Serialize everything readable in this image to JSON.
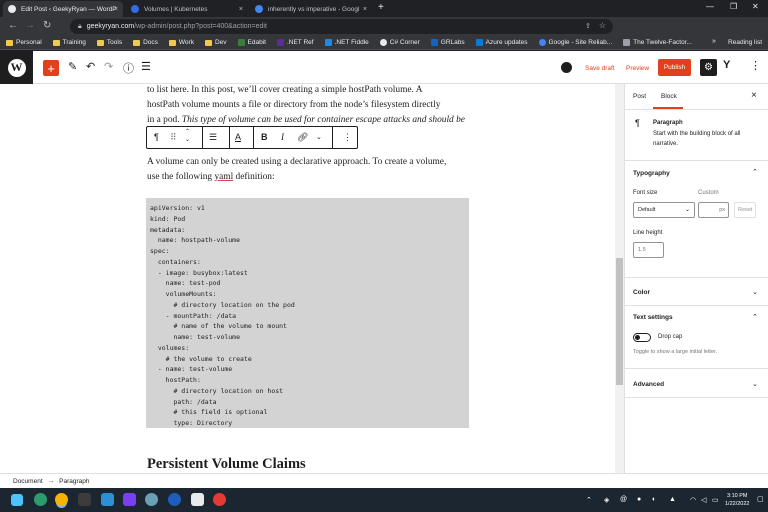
{
  "browser": {
    "tabs": [
      {
        "title": "Edit Post ‹ GeekyRyan — WordP",
        "close": "×"
      },
      {
        "title": "Volumes | Kubernetes",
        "close": "×"
      },
      {
        "title": "inherently vs imperative - Googl",
        "close": "×"
      }
    ],
    "new_tab": "+",
    "address": {
      "host": "geekyryan.com",
      "path": "/wp-admin/post.php?post=400&action=edit"
    },
    "bookmarks": [
      {
        "label": "Personal",
        "kind": "folder"
      },
      {
        "label": "Training",
        "kind": "folder"
      },
      {
        "label": "Tools",
        "kind": "folder"
      },
      {
        "label": "Docs",
        "kind": "folder"
      },
      {
        "label": "Work",
        "kind": "folder"
      },
      {
        "label": "Dev",
        "kind": "folder"
      },
      {
        "label": "Edabit",
        "kind": "site",
        "color": "#3b7d3b"
      },
      {
        "label": ".NET Ref",
        "kind": "site",
        "color": "#5c2d91"
      },
      {
        "label": ".NET Fiddle",
        "kind": "site",
        "color": "#1e88e5"
      },
      {
        "label": "C# Corner",
        "kind": "site",
        "color": "#e8eaed"
      },
      {
        "label": "GRLabs",
        "kind": "site",
        "color": "#1565c0"
      },
      {
        "label": "Azure updates",
        "kind": "site",
        "color": "#0a7bd4"
      },
      {
        "label": "Google - Site Reliab...",
        "kind": "site",
        "color": "#4285f4"
      },
      {
        "label": "The Twelve-Factor...",
        "kind": "site",
        "color": "#9aa0a6"
      }
    ],
    "reading_list": "Reading list"
  },
  "wp_header": {
    "save_draft": "Save draft",
    "preview": "Preview",
    "publish": "Publish"
  },
  "editor": {
    "para1": [
      "to list here. In this post, we’ll cover creating a simple hostPath volume. A",
      "hostPath volume mounts a file or directory from the node’s filesystem directly",
      "in a pod. "
    ],
    "para1_italic": "This type of volume can be used for container escape attacks and should be",
    "para2_line1": "A volume can only be created using a declarative approach. To create a volume,",
    "para2_line2_a": "use the following ",
    "para2_line2_link": "yaml",
    "para2_line2_b": " definition:",
    "code": "apiVersion: v1\nkind: Pod\nmetadata:\n  name: hostpath-volume\nspec:\n  containers:\n  - image: busybox:latest\n    name: test-pod\n    volumeMounts:\n      # directory location on the pod\n    - mountPath: /data\n      # name of the volume to mount\n      name: test-volume\n  volumes:\n    # the volume to create\n  - name: test-volume\n    hostPath:\n      # directory location on host\n      path: /data\n      # this field is optional\n      type: Directory",
    "heading": "Persistent Volume Claims"
  },
  "sidebar": {
    "tab_post": "Post",
    "tab_block": "Block",
    "close": "×",
    "block_name": "Paragraph",
    "block_desc1": "Start with the building block of all",
    "block_desc2": "narrative.",
    "typography": "Typography",
    "font_size_label": "Font size",
    "custom_label": "Custom",
    "font_size_value": "Default",
    "custom_unit": "px",
    "reset": "Reset",
    "line_height_label": "Line height",
    "line_height_placeholder": "1.5",
    "color": "Color",
    "text_settings": "Text settings",
    "drop_cap": "Drop cap",
    "drop_cap_help": "Toggle to show a large initial letter.",
    "advanced": "Advanced"
  },
  "statusbar": {
    "crumb1": "Document",
    "arrow": "→",
    "crumb2": "Paragraph"
  },
  "taskbar": {
    "time": "3:10 PM",
    "date": "1/22/2022"
  },
  "colors": {
    "wp_accent": "#e2401c",
    "code_bg": "#d3d3d3",
    "taskbar": "#1c2631"
  }
}
